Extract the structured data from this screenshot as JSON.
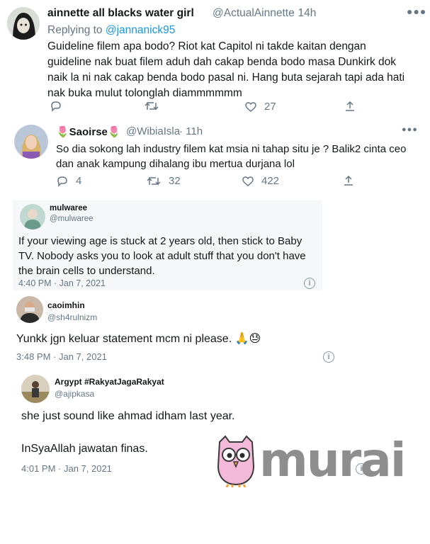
{
  "tweet1": {
    "display_name": "ainnette all blacks water girl",
    "handle": "@ActualAinnette",
    "time": "· 14h",
    "replying_prefix": "Replying to",
    "replying_to": "@jannanick95",
    "text": "Guideline filem apa bodo? Riot kat Capitol ni takde kaitan dengan guideline nak buat filem aduh dah cakap benda bodo masa Dunkirk dok naik la ni nak cakap benda bodo pasal ni. Hang buta sejarah tapi ada hati nak buka mulut tolonglah diammmmmm",
    "likes": "27"
  },
  "tweet2": {
    "display_name": "🌷Saoirse🌷",
    "handle": "@WibiaIsla",
    "time": "· 11h",
    "text": "So dia sokong lah industry filem kat msia ni tahap situ je ? Balik2 cinta ceo dan anak kampung dihalang ibu mertua durjana lol",
    "replies": "4",
    "retweets": "32",
    "likes": "422"
  },
  "tweet3": {
    "display_name": "mulwaree",
    "handle": "@mulwaree",
    "text": "If your viewing age is stuck at 2 years old, then stick to Baby TV. Nobody asks you to look at adult stuff that you don't have the brain cells to understand.",
    "timestamp": "4:40 PM · Jan 7, 2021"
  },
  "tweet4": {
    "display_name": "caoimhin",
    "handle": "@sh4rulnizm",
    "text": "Yunkk jgn keluar statement mcm ni please. 🙏😓",
    "timestamp": "3:48 PM · Jan 7, 2021"
  },
  "tweet5": {
    "display_name": "Argypt #RakyatJagaRakyat",
    "handle": "@ajipkasa",
    "text_line1": "she just sound like ahmad idham last year.",
    "text_line2": "InSyaAllah jawatan finas.",
    "timestamp": "4:01 PM · Jan 7, 2021"
  },
  "watermark": {
    "text": "murai",
    "color": "#8e8e8e",
    "owl_color": "#f4b8d8"
  },
  "colors": {
    "link": "#1b95e0",
    "muted": "#657786",
    "card_bg": "#f5f7f9"
  },
  "icons": [
    "reply-icon",
    "retweet-icon",
    "like-icon",
    "share-icon",
    "more-icon",
    "info-icon"
  ]
}
